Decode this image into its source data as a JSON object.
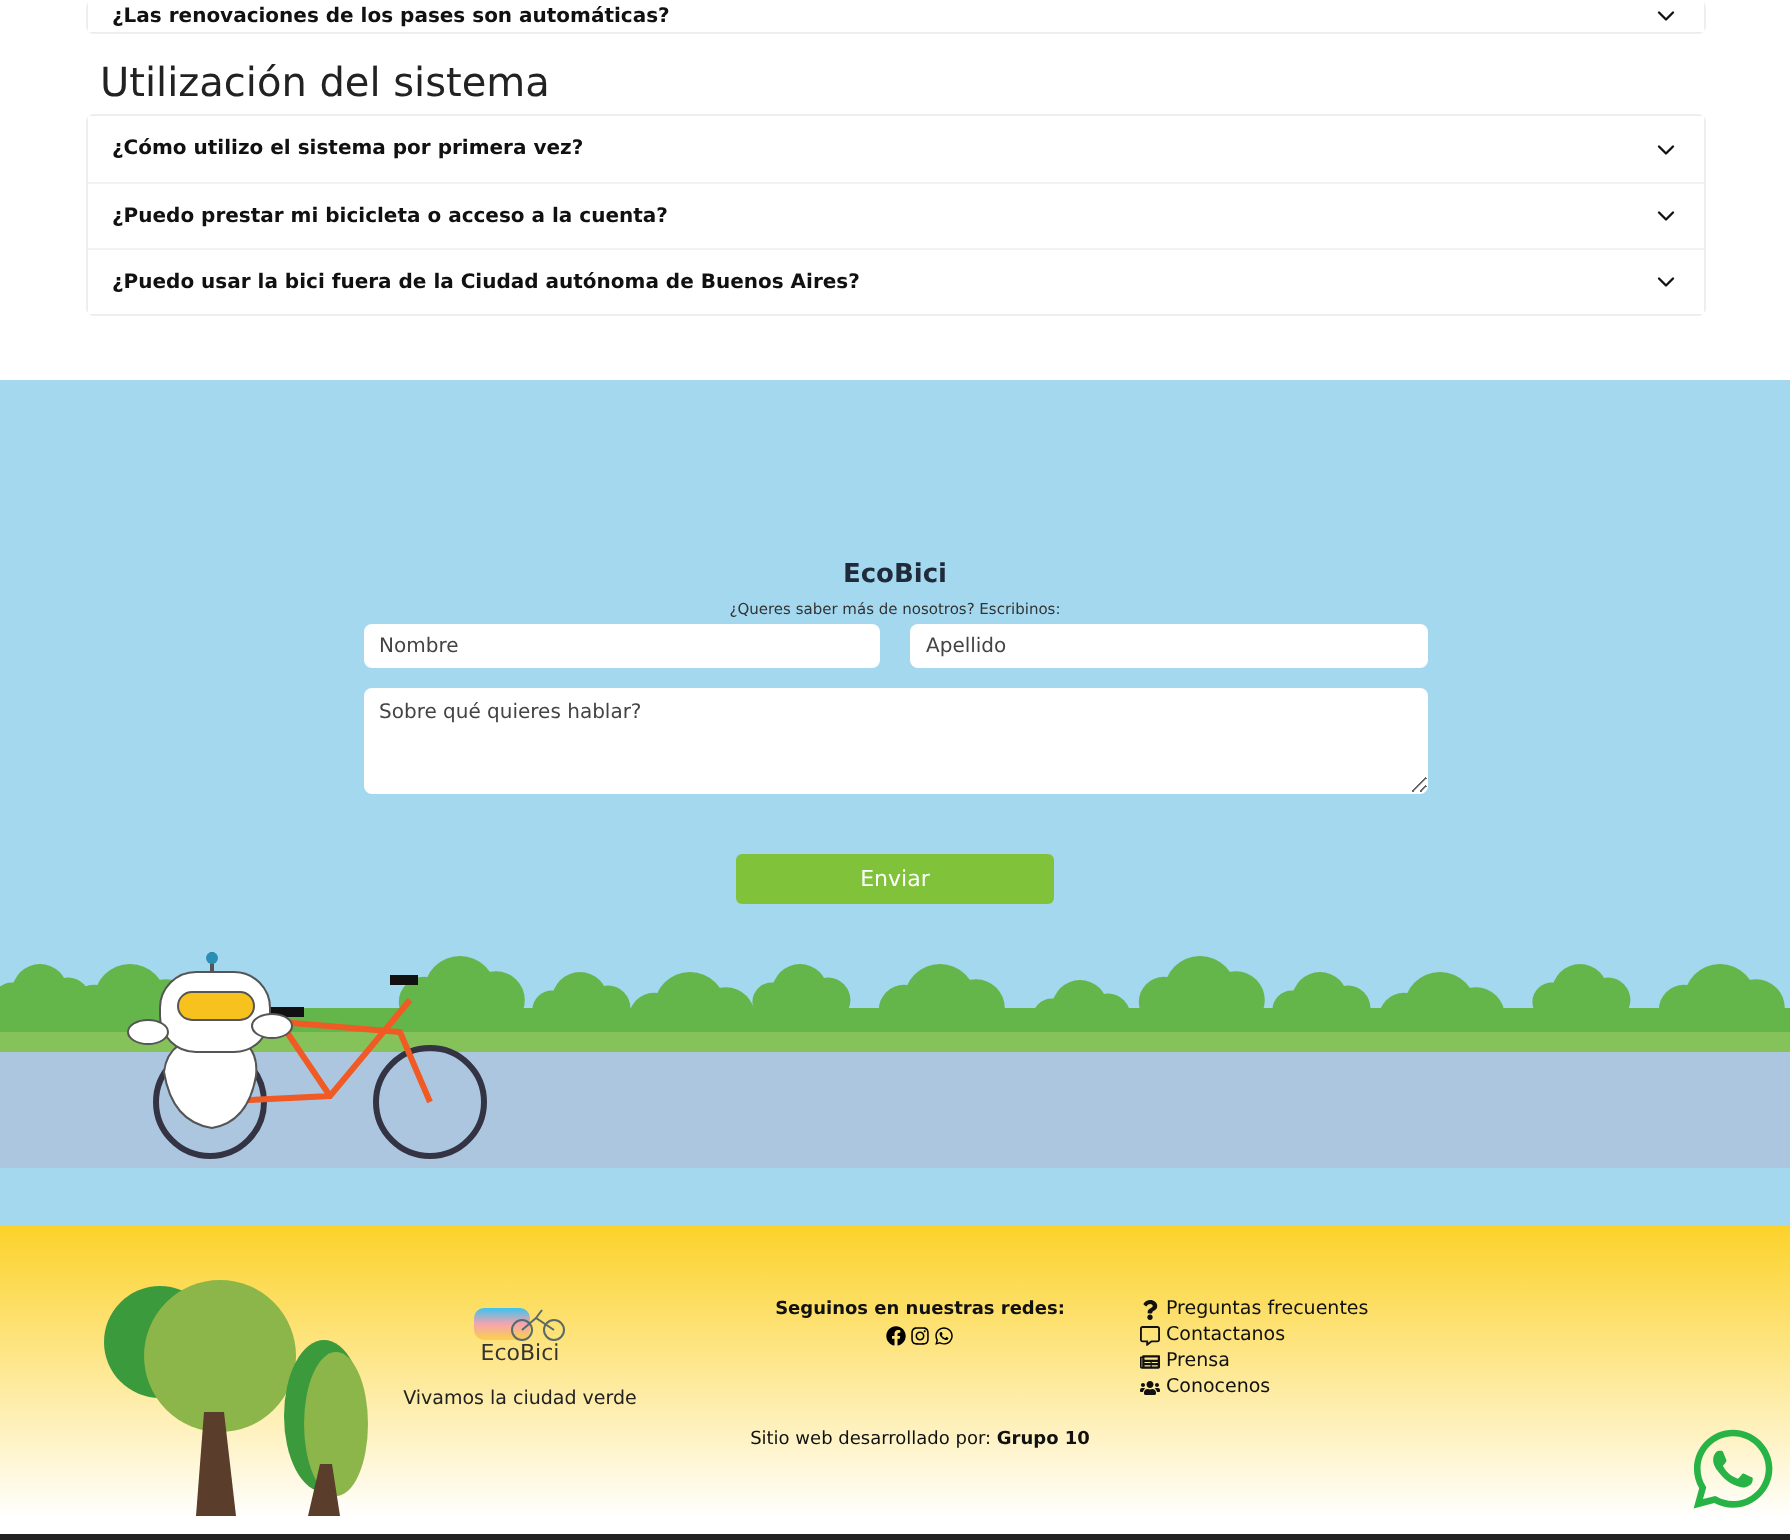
{
  "faq_top": {
    "question": "¿Las renovaciones de los pases son automáticas?",
    "expanded": false
  },
  "faq_section": {
    "title": "Utilización del sistema",
    "items": [
      {
        "question": "¿Cómo utilizo el sistema por primera vez?",
        "expanded": false
      },
      {
        "question": "¿Puedo prestar mi bicicleta o acceso a la cuenta?",
        "expanded": false
      },
      {
        "question": "¿Puedo usar la bici fuera de la Ciudad autónoma de Buenos Aires?",
        "expanded": false
      }
    ]
  },
  "contact": {
    "title": "EcoBici",
    "subtitle": "¿Queres saber más de nosotros? Escribinos:",
    "first_name": {
      "placeholder": "Nombre"
    },
    "last_name": {
      "placeholder": "Apellido"
    },
    "message": {
      "placeholder": "Sobre qué quieres hablar?"
    },
    "submit": "Enviar"
  },
  "footer": {
    "logo_text": "EcoBici",
    "slogan": "Vivamos la ciudad verde",
    "social_title": "Seguinos en nuestras redes:",
    "credits": "Sitio web desarrollado por: **Grupo 10**",
    "links": [
      {
        "label": "Preguntas frecuentes",
        "kind": "question"
      },
      {
        "label": "Contactanos",
        "kind": "comment"
      },
      {
        "label": "Prensa",
        "kind": "news"
      },
      {
        "label": "Conocenos",
        "kind": "people"
      }
    ]
  }
}
